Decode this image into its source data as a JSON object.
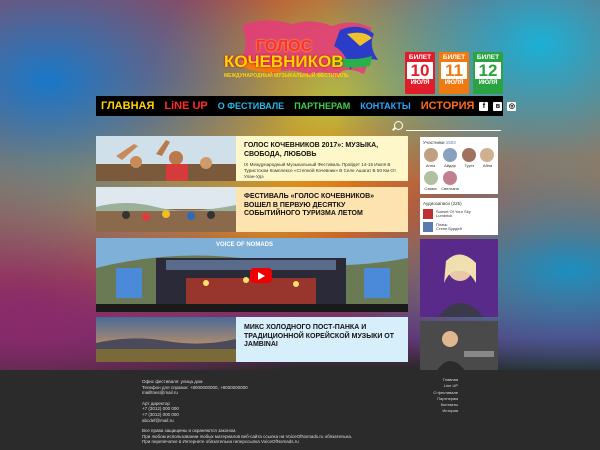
{
  "logo": {
    "title1": "ГОЛОС",
    "title2": "КОЧЕВНИКОВ",
    "subtitle": "МЕЖДУНАРОДНЫЙ МУЗЫКАЛЬНЫЙ ФЕСТИВАЛЬ"
  },
  "tickets": [
    {
      "label": "БИЛЕТ",
      "day": "10",
      "month": "ИЮЛЯ",
      "color": "#e21d2b"
    },
    {
      "label": "БИЛЕТ",
      "day": "11",
      "month": "ИЮЛЯ",
      "color": "#f07a12"
    },
    {
      "label": "БИЛЕТ",
      "day": "12",
      "month": "ИЮЛЯ",
      "color": "#2aa341"
    }
  ],
  "nav": [
    {
      "label": "ГЛАВНАЯ",
      "color": "#ffd400"
    },
    {
      "label": "LiNE UP",
      "color": "#ff2a2a"
    },
    {
      "label": "О ФЕСТИВАЛЕ",
      "color": "#27b7e8"
    },
    {
      "label": "ПАРТНЕРАМ",
      "color": "#3fd04a"
    },
    {
      "label": "КОНТАКТЫ",
      "color": "#2fa6ff"
    },
    {
      "label": "ИСТОРИЯ",
      "color": "#ff6a1a"
    }
  ],
  "social": [
    "facebook-icon",
    "vk-icon",
    "instagram-icon"
  ],
  "cards": [
    {
      "title": "ГОЛОС КОЧЕВНИКОВ 2017»: МУЗЫКА, СВОБОДА, ЛЮБОВЬ",
      "subtitle": "IX Международный Музыкальный Фестиваль Пройдет 14-15 Июля В Туристском Комплексе «Степной Кочевник» В Селе Ашагат В 50 Км От Улан-Удэ",
      "bg": "#fdf7c9"
    },
    {
      "title": "ФЕСТИВАЛЬ «ГОЛОС КОЧЕВНИКОВ» ВОШЕЛ В ПЕРВУЮ ДЕСЯТКУ СОБЫТИЙНОГО ТУРИЗМА ЛЕТОМ",
      "subtitle": "",
      "bg": "#fde3b0"
    },
    {
      "title": "МИКС ХОЛОДНОГО ПОСТ-ПАНКА И ТРАДИЦИОННОЙ КОРЕЙСКОЙ МУЗЫКИ ОТ JAMBINAI",
      "subtitle": "",
      "bg": "#d7eefb"
    }
  ],
  "video": {
    "overlay": "VOICE OF NOMADS"
  },
  "members": {
    "header": "Участники",
    "count": "1503",
    "people": [
      "Анна",
      "Айдар",
      "Тургэ",
      "Айна",
      "Сэжмэ",
      "Светлана"
    ]
  },
  "audio": {
    "header": "Аудиозаписи (225)",
    "tracks": [
      {
        "title": "Sunset Of Your Sky",
        "artist": "Lumbrick"
      },
      {
        "title": "Плачь",
        "artist": "Степн Бурдей"
      }
    ]
  },
  "footer": {
    "lines": [
      "Офис фестиваля: улица дом",
      "Телефон для справок: +8000000000, +8000000000",
      "mailltnes@mail.ru",
      "",
      "Арт директор",
      "+7 (3012) 000 000",
      "+7 (3012) 000 000",
      "abcdef@mail.ru",
      "",
      "Все права защищены и охраняются законом.",
      "При любом использовании любых материалов веб-сайта ссылка на VoiceOfNomads.ru обязательна.",
      "При перепечатке в Интернете обязательна гиперссылка VoiceOfNomads.ru"
    ],
    "links": [
      "Главная",
      "Line UP",
      "О фестивале",
      "Партнерам",
      "Контакты",
      "История"
    ]
  }
}
